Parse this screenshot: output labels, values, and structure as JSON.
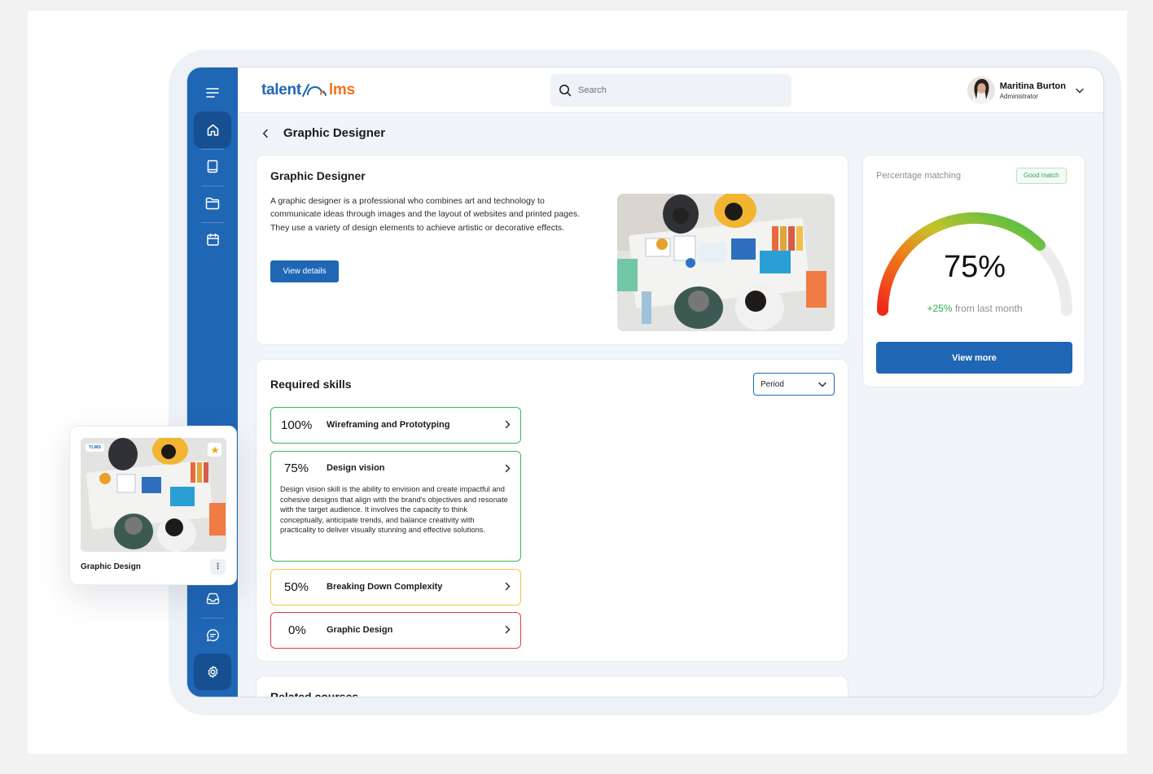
{
  "brand": {
    "part1": "talent",
    "part2": "lms",
    "primary": "#1f66b5",
    "accent": "#f2731c"
  },
  "sidebar": {
    "top_items": [
      {
        "icon": "menu-icon"
      },
      {
        "icon": "home-icon",
        "active": true
      },
      {
        "icon": "book-icon"
      },
      {
        "icon": "folder-icon"
      },
      {
        "icon": "calendar-icon"
      }
    ],
    "bottom_items": [
      {
        "icon": "inbox-icon"
      },
      {
        "icon": "chat-icon"
      },
      {
        "icon": "gear-icon",
        "active": true
      }
    ]
  },
  "header": {
    "search_placeholder": "Search",
    "user_name": "Maritina Burton",
    "user_role": "Administrator"
  },
  "page": {
    "title": "Graphic Designer"
  },
  "overview": {
    "title": "Graphic Designer",
    "description": "A graphic designer is a professional who combines art and technology to communicate ideas through images and the layout of websites and printed pages. They use a variety of design elements to achieve artistic or decorative effects.",
    "button": "View details"
  },
  "skills": {
    "title": "Required skills",
    "period_label": "Period",
    "items": [
      {
        "percent": "100%",
        "name": "Wireframing and Prototyping",
        "color": "#3fb35a"
      },
      {
        "percent": "75%",
        "name": "Design vision",
        "color": "#3fb35a",
        "description": "Design vision skill is the ability to envision and create impactful and cohesive designs that align with the brand's objectives and resonate with the target audience. It involves the capacity to think conceptually, anticipate trends, and balance creativity with practicality to deliver visually stunning and effective solutions."
      },
      {
        "percent": "50%",
        "name": "Breaking Down Complexity",
        "color": "#f4c542"
      },
      {
        "percent": "0%",
        "name": "Graphic Design",
        "color": "#e23b3b"
      }
    ]
  },
  "related": {
    "title": "Related courses"
  },
  "matching": {
    "label": "Percentage matching",
    "badge": "Good match",
    "value": "75%",
    "fraction": 0.75,
    "delta": "+25%",
    "delta_suffix": "from last month",
    "button": "View more"
  },
  "course_card": {
    "tag": "TLMS",
    "title": "Graphic Design"
  }
}
